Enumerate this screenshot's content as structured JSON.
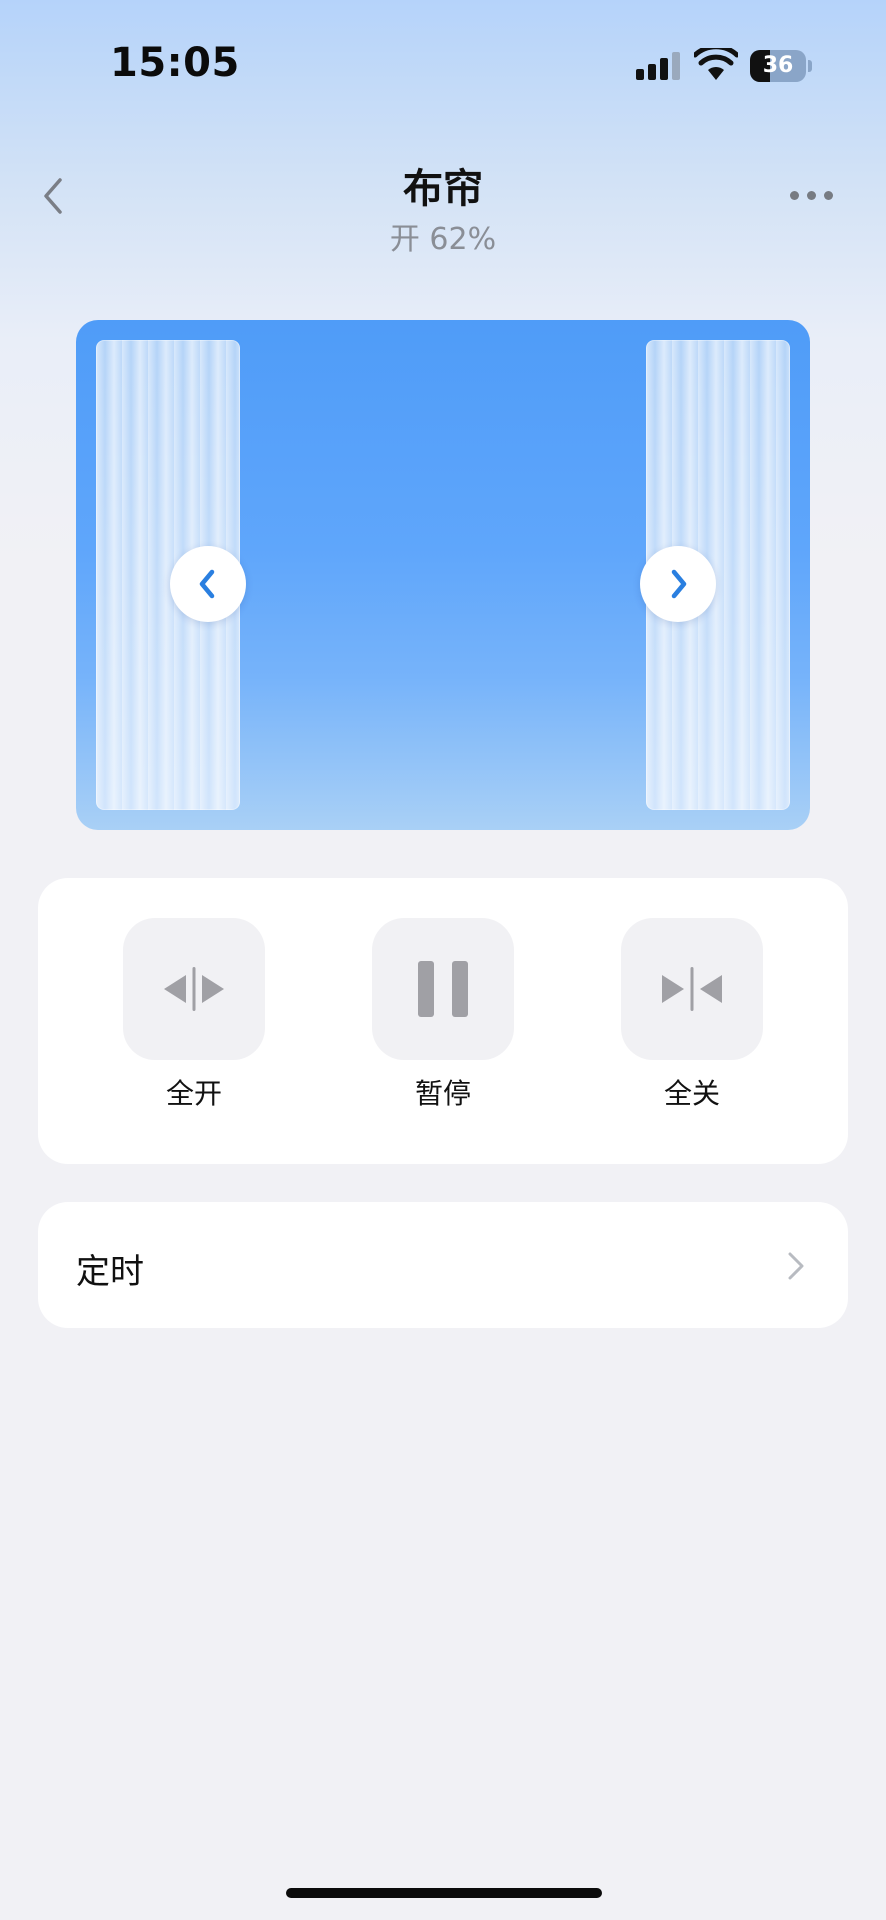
{
  "status": {
    "time": "15:05",
    "battery": "36",
    "battery_level": 0.36
  },
  "header": {
    "title": "布帘",
    "subtitle": "开 62%"
  },
  "curtain": {
    "open_percent": 62
  },
  "controls": [
    {
      "label": "全开",
      "icon": "open-all-icon"
    },
    {
      "label": "暂停",
      "icon": "pause-icon"
    },
    {
      "label": "全关",
      "icon": "close-all-icon"
    }
  ],
  "timer": {
    "label": "定时"
  },
  "colors": {
    "accent": "#2a7fe0",
    "card_blue": "#5fa6fb",
    "icon_gray": "#a0a0a5"
  }
}
